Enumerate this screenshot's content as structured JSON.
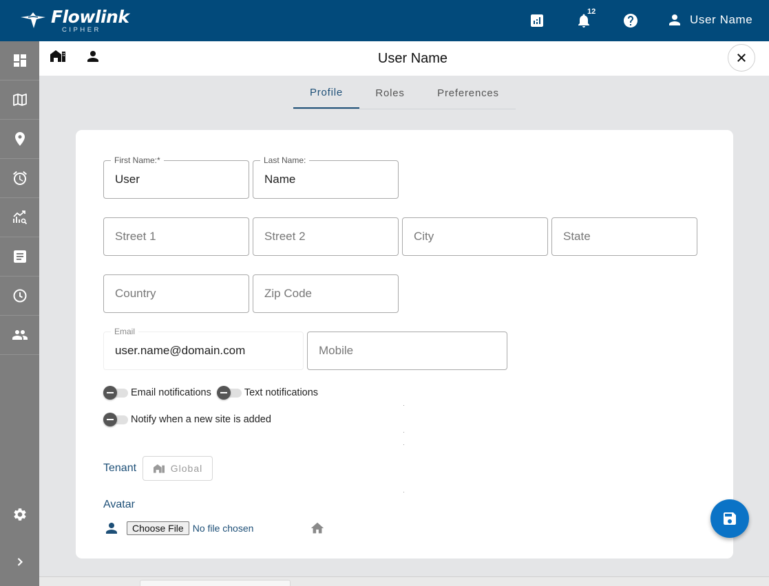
{
  "brand": {
    "name": "Flowlink",
    "sub": "CIPHER"
  },
  "topbar": {
    "notification_count": "12",
    "user_label": "User Name",
    "icons": [
      "report-icon",
      "bell-icon",
      "help-icon",
      "person-icon"
    ]
  },
  "sidebar": {
    "items": [
      {
        "icon": "dashboard-icon"
      },
      {
        "icon": "map-icon"
      },
      {
        "icon": "location-pin-icon"
      },
      {
        "icon": "alarm-icon"
      },
      {
        "icon": "analytics-icon"
      },
      {
        "icon": "document-icon"
      },
      {
        "icon": "history-icon"
      },
      {
        "icon": "users-icon"
      }
    ],
    "bottom": [
      {
        "icon": "gear-icon"
      },
      {
        "icon": "chevron-right-icon"
      }
    ]
  },
  "header": {
    "title": "User Name"
  },
  "tabs": [
    {
      "label": "Profile",
      "active": true
    },
    {
      "label": "Roles",
      "active": false
    },
    {
      "label": "Preferences",
      "active": false
    }
  ],
  "form": {
    "first_name": {
      "label": "First Name:*",
      "value": "User"
    },
    "last_name": {
      "label": "Last Name:",
      "value": "Name"
    },
    "street1": {
      "placeholder": "Street 1"
    },
    "street2": {
      "placeholder": "Street 2"
    },
    "city": {
      "placeholder": "City"
    },
    "state": {
      "placeholder": "State"
    },
    "country": {
      "placeholder": "Country"
    },
    "zip": {
      "placeholder": "Zip Code"
    },
    "email": {
      "label": "Email",
      "value": "user.name@domain.com"
    },
    "mobile": {
      "placeholder": "Mobile"
    }
  },
  "toggles": {
    "email_notifications": "Email notifications",
    "text_notifications": "Text notifications",
    "notify_new_site": "Notify when a new site is added"
  },
  "tenant": {
    "label": "Tenant",
    "value": "Global"
  },
  "avatar": {
    "label": "Avatar",
    "choose_file": "Choose File",
    "no_file": "No file chosen"
  },
  "colors": {
    "brand": "#024a7b",
    "sidebar": "#7e7e7e",
    "accent": "#1d4f77",
    "fab": "#0b73c6"
  }
}
